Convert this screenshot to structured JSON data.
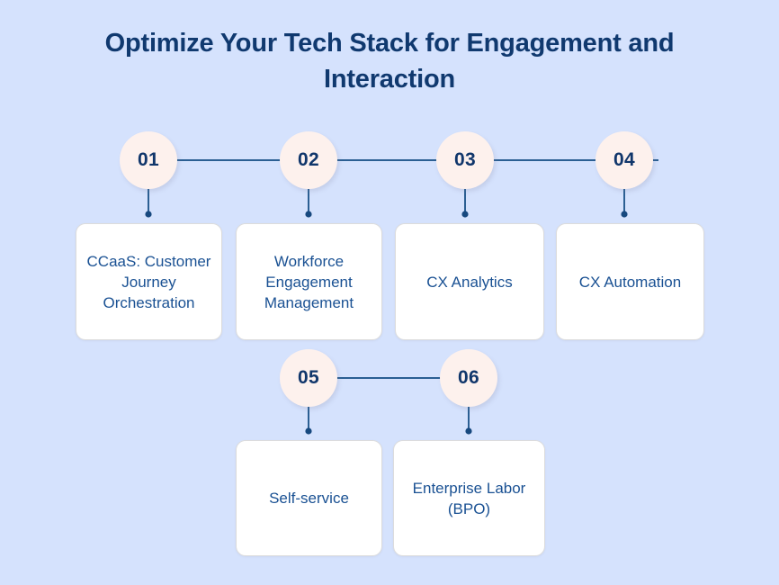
{
  "header": {
    "title": "Optimize Your Tech Stack for Engagement and Interaction"
  },
  "colors": {
    "background": "#d5e2fd",
    "title_text": "#10396f",
    "circle_fill": "#fdf1ed",
    "circle_text": "#10366b",
    "card_background": "#ffffff",
    "card_border": "#dcdcdc",
    "card_text": "#1a5193",
    "connector_line": "#2b5f93"
  },
  "diagram": {
    "type": "numbered-step-flow",
    "row1": [
      {
        "number": "01",
        "label": "CCaaS: Customer Journey Orchestration"
      },
      {
        "number": "02",
        "label": "Workforce Engagement Management"
      },
      {
        "number": "03",
        "label": "CX Analytics"
      },
      {
        "number": "04",
        "label": "CX Automation"
      }
    ],
    "row2": [
      {
        "number": "05",
        "label": "Self-service"
      },
      {
        "number": "06",
        "label": "Enterprise Labor (BPO)"
      }
    ]
  }
}
